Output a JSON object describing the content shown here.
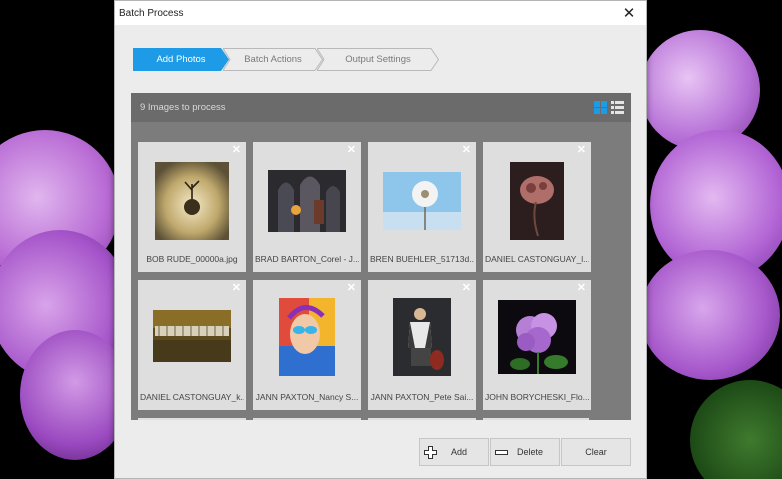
{
  "dialog": {
    "title": "Batch Process",
    "close_symbol": "✕"
  },
  "steps": [
    {
      "label": "Add Photos",
      "state": "active"
    },
    {
      "label": "Batch Actions",
      "state": "inactive"
    },
    {
      "label": "Output Settings",
      "state": "inactive"
    }
  ],
  "panel": {
    "count_text": "9 Images to process",
    "view_modes": [
      {
        "icon": "grid-view-icon",
        "selected": true
      },
      {
        "icon": "list-view-icon",
        "selected": false
      }
    ]
  },
  "images": [
    {
      "name": "BOB RUDE_00000a.jpg",
      "remove_symbol": "✕"
    },
    {
      "name": "BRAD BARTON_Corel - J...",
      "remove_symbol": "✕"
    },
    {
      "name": "BREN BUEHLER_51713d...",
      "remove_symbol": "✕"
    },
    {
      "name": "DANIEL CASTONGUAY_l...",
      "remove_symbol": "✕"
    },
    {
      "name": "DANIEL CASTONGUAY_k...",
      "remove_symbol": "✕"
    },
    {
      "name": "JANN PAXTON_Nancy S...",
      "remove_symbol": "✕"
    },
    {
      "name": "JANN PAXTON_Pete Sai...",
      "remove_symbol": "✕"
    },
    {
      "name": "JOHN BORYCHESKI_Flo...",
      "remove_symbol": "✕"
    }
  ],
  "footer": {
    "add_label": "Add",
    "delete_label": "Delete",
    "clear_label": "Clear"
  },
  "colors": {
    "accent": "#1e9be6",
    "panel": "#7c7c7c",
    "panel_header": "#6b6b6b",
    "background_flower": "#b46ad0"
  }
}
